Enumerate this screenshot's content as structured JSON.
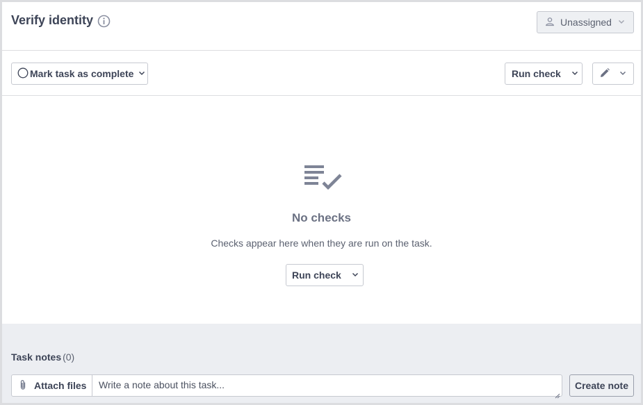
{
  "header": {
    "title": "Verify identity",
    "assignee_label": "Unassigned"
  },
  "toolbar": {
    "mark_complete_label": "Mark task as complete",
    "run_check_label": "Run check"
  },
  "empty_state": {
    "title": "No checks",
    "description": "Checks appear here when they are run on the task.",
    "run_check_label": "Run check"
  },
  "notes": {
    "label": "Task notes",
    "count": "(0)",
    "attach_label": "Attach files",
    "placeholder": "Write a note about this task...",
    "create_label": "Create note"
  },
  "colors": {
    "text_primary": "#3d4457",
    "icon_muted": "#8a8fa0",
    "notes_background": "#eceef2"
  }
}
